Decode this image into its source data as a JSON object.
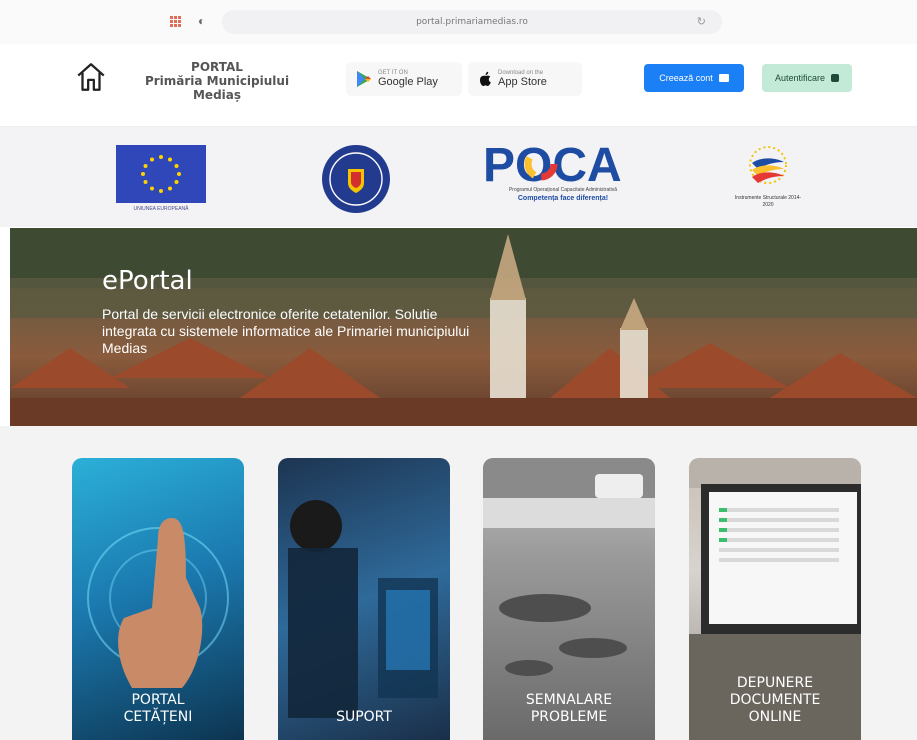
{
  "browser": {
    "url": "portal.primariamedias.ro",
    "icons": [
      "apps-grid-icon",
      "privacy-shield-icon",
      "reload-icon"
    ]
  },
  "header": {
    "brand_line1": "PORTAL",
    "brand_line2": "Primăria Municipiului",
    "brand_line3": "Mediaș",
    "google_play": {
      "small": "GET IT ON",
      "big": "Google Play"
    },
    "app_store": {
      "small": "Download on the",
      "big": "App Store"
    },
    "create_account": "Creează cont",
    "login": "Autentificare",
    "colors": {
      "create_bg": "#1b7ff5",
      "login_bg": "#c2ead6"
    }
  },
  "partners": {
    "eu_caption": "UNIUNEA EUROPEANĂ",
    "poca_title": "POCA",
    "poca_sub1": "Programul Operațional Capacitate Administrativă",
    "poca_sub2": "Competența face diferența!",
    "is_caption": "Instrumente Structurale 2014-2020"
  },
  "hero": {
    "title": "ePortal",
    "description": "Portal de servicii electronice oferite cetatenilor. Solutie integrata cu sistemele informatice ale Primariei municipiului Medias"
  },
  "cards": [
    {
      "label": "PORTAL\nCETĂȚENI"
    },
    {
      "label": "SUPORT"
    },
    {
      "label": "SEMNALARE\nPROBLEME"
    },
    {
      "label": "DEPUNERE\nDOCUMENTE\nONLINE"
    }
  ]
}
